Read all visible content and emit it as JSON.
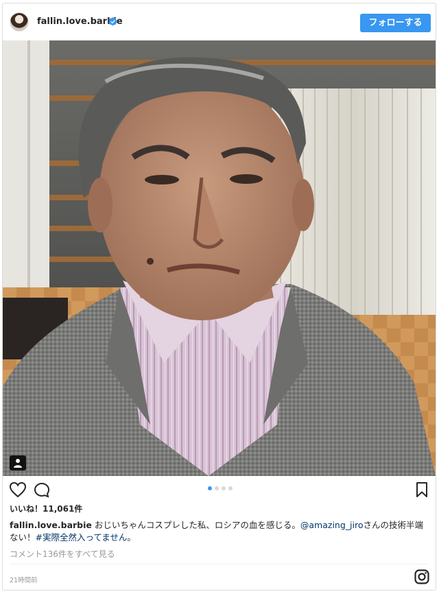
{
  "header": {
    "username": "fallin.love.barbie",
    "follow_label": "フォローする"
  },
  "post": {
    "likes": "いいね！11,061件",
    "caption_user": "fallin.love.barbie",
    "caption_text_1": "おじいちゃんコスプレした私、ロシアの血を感じる。",
    "mention": "@amazing_jiro",
    "caption_text_2": "さんの技術半端ない！",
    "hashtag": "#実際全然入ってません",
    "caption_end": "。",
    "view_comments": "コメント136件をすべて見る",
    "timestamp": "21時間前",
    "carousel_total": 4,
    "carousel_active": 1
  },
  "colors": {
    "accent": "#3897f0",
    "link": "#003569"
  },
  "icons": [
    "verified-icon",
    "user-tag-icon",
    "heart-icon",
    "comment-icon",
    "bookmark-icon",
    "instagram-logo-icon"
  ]
}
